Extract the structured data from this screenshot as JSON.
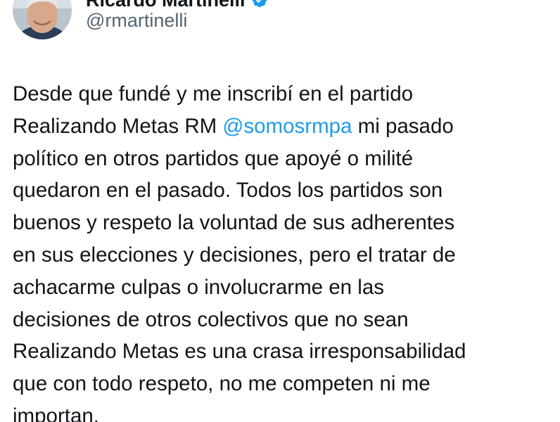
{
  "author": {
    "display_name": "Ricardo Martinelli",
    "handle": "@rmartinelli",
    "verified_icon": "verified-badge-icon",
    "avatar": "profile-photo"
  },
  "tweet": {
    "text_part1": "Desde que fundé y me inscribí en  el partido\nRealizando Metas RM ",
    "mention": "@somosrmpa",
    "text_part2": " mi pasado\npolítico en otros partidos que apoyé o milité\nquedaron en el pasado. Todos los partidos son\nbuenos y respeto la voluntad de sus adherentes\nen sus elecciones y decisiones, pero el tratar de\nachacarme culpas o involucrarme en las\ndecisiones de otros colectivos que no sean\nRealizando Metas es una crasa irresponsabilidad\nque con todo respeto, no me competen ni me\nimportan."
  },
  "colors": {
    "text": "#0f1419",
    "secondary_text": "#536471",
    "link": "#1d9bf0",
    "background": "#ffffff"
  }
}
